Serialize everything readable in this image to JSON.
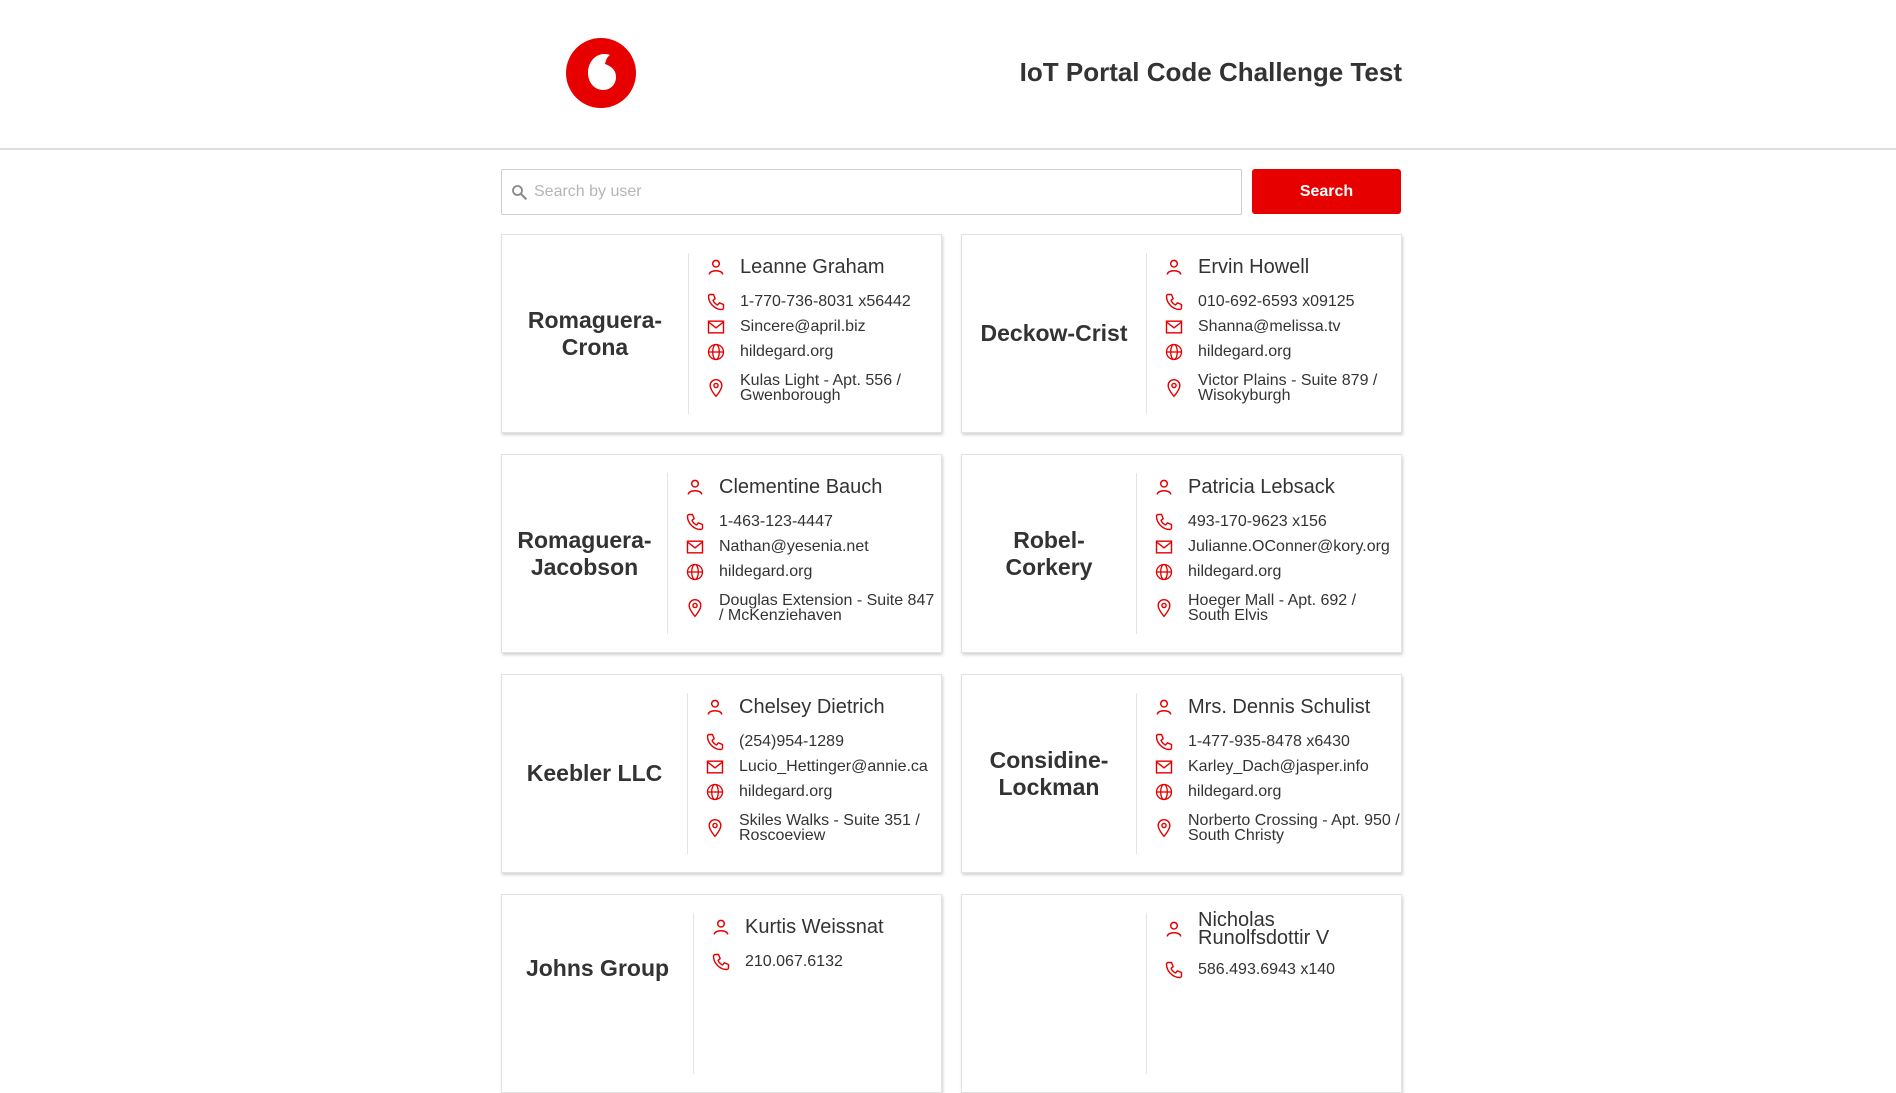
{
  "header": {
    "title": "IoT Portal Code Challenge Test",
    "logo": "vodafone-logo"
  },
  "search": {
    "placeholder": "Search by user",
    "value": "",
    "button_label": "Search",
    "icon": "search-icon"
  },
  "brand_color": "#e60000",
  "cards": [
    {
      "company": "Romaguera-Crona",
      "name": "Leanne Graham",
      "phone": "1-770-736-8031 x56442",
      "email": "Sincere@april.biz",
      "website": "hildegard.org",
      "address": "Kulas Light - Apt. 556 / Gwenborough"
    },
    {
      "company": "Deckow-Crist",
      "name": "Ervin Howell",
      "phone": "010-692-6593 x09125",
      "email": "Shanna@melissa.tv",
      "website": "hildegard.org",
      "address": "Victor Plains - Suite 879 / Wisokyburgh"
    },
    {
      "company": "Romaguera-Jacobson",
      "name": "Clementine Bauch",
      "phone": "1-463-123-4447",
      "email": "Nathan@yesenia.net",
      "website": "hildegard.org",
      "address": "Douglas Extension - Suite 847 / McKenziehaven"
    },
    {
      "company": "Robel-Corkery",
      "name": "Patricia Lebsack",
      "phone": "493-170-9623 x156",
      "email": "Julianne.OConner@kory.org",
      "website": "hildegard.org",
      "address": "Hoeger Mall - Apt. 692 / South Elvis"
    },
    {
      "company": "Keebler LLC",
      "name": "Chelsey Dietrich",
      "phone": "(254)954-1289",
      "email": "Lucio_Hettinger@annie.ca",
      "website": "hildegard.org",
      "address": "Skiles Walks - Suite 351 / Roscoeview"
    },
    {
      "company": "Considine-Lockman",
      "name": "Mrs. Dennis Schulist",
      "phone": "1-477-935-8478 x6430",
      "email": "Karley_Dach@jasper.info",
      "website": "hildegard.org",
      "address": "Norberto Crossing - Apt. 950 / South Christy"
    },
    {
      "company": "Johns Group",
      "name": "Kurtis Weissnat",
      "phone": "210.067.6132",
      "email": "",
      "website": "",
      "address": ""
    },
    {
      "company": "",
      "name": "Nicholas Runolfsdottir V",
      "phone": "586.493.6943 x140",
      "email": "",
      "website": "",
      "address": ""
    }
  ]
}
